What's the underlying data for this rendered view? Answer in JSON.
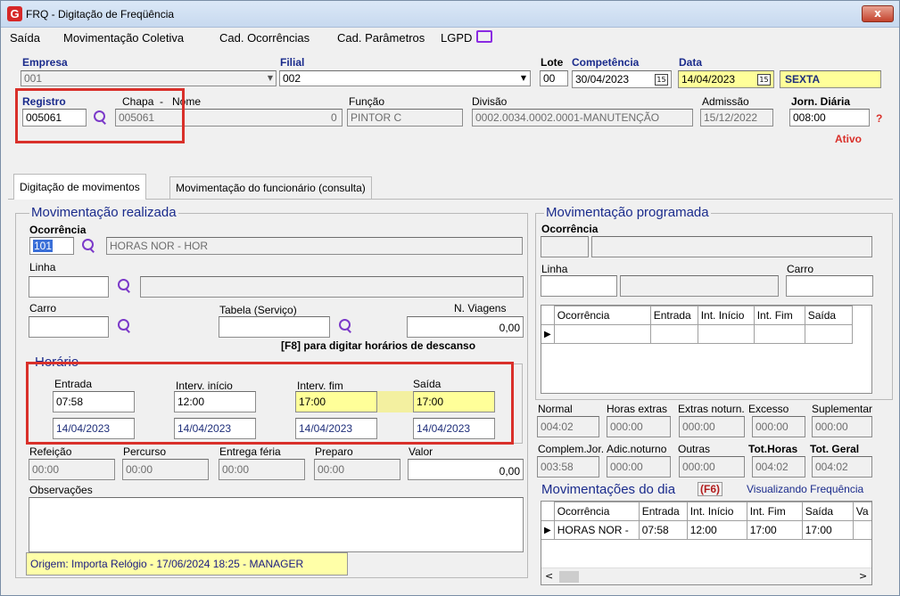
{
  "window": {
    "title": "FRQ - Digitação de Freqüência",
    "close_label": "x",
    "logo": "G"
  },
  "menu": [
    "Saída",
    "Movimentação Coletiva",
    "Cad. Ocorrências",
    "Cad. Parâmetros",
    "LGPD"
  ],
  "header": {
    "empresa_label": "Empresa",
    "empresa_value": "001",
    "filial_label": "Filial",
    "filial_value": "002",
    "lote_label": "Lote",
    "lote_value": "00",
    "competencia_label": "Competência",
    "competencia_value": "30/04/2023",
    "data_label": "Data",
    "data_value": "14/04/2023",
    "dia_semana": "SEXTA",
    "registro_label": "Registro",
    "registro_value": "005061",
    "chapa_label": "Chapa",
    "nome_label": "Nome",
    "chapa_value": "005061",
    "nome_value": "0",
    "funcao_label": "Função",
    "funcao_value": "PINTOR C",
    "divisao_label": "Divisão",
    "divisao_value": "0002.0034.0002.0001-MANUTENÇÃO",
    "admissao_label": "Admissão",
    "admissao_value": "15/12/2022",
    "jornada_label": "Jorn. Diária",
    "jornada_value": "008:00",
    "help": "?",
    "status": "Ativo"
  },
  "tabs": [
    "Digitação de movimentos",
    "Movimentação do funcionário (consulta)"
  ],
  "realizada": {
    "title": "Movimentação realizada",
    "ocorrencia_label": "Ocorrência",
    "ocorrencia_code": "101",
    "ocorrencia_desc": "HORAS NOR - HOR",
    "linha_label": "Linha",
    "carro_label": "Carro",
    "tabela_label": "Tabela (Serviço)",
    "viagens_label": "N. Viagens",
    "viagens_value": "0,00",
    "f8_hint": "[F8] para digitar horários de descanso"
  },
  "horario": {
    "title": "Horário",
    "cols": [
      {
        "label": "Entrada",
        "time": "07:58",
        "date": "14/04/2023"
      },
      {
        "label": "Interv. início",
        "time": "12:00",
        "date": "14/04/2023"
      },
      {
        "label": "Interv. fim",
        "time": "17:00",
        "date": "14/04/2023"
      },
      {
        "label": "Saída",
        "time": "17:00",
        "date": "14/04/2023"
      }
    ]
  },
  "extras": [
    {
      "label": "Refeição",
      "value": "00:00"
    },
    {
      "label": "Percurso",
      "value": "00:00"
    },
    {
      "label": "Entrega féria",
      "value": "00:00"
    },
    {
      "label": "Preparo",
      "value": "00:00"
    },
    {
      "label": "Valor",
      "value": "0,00"
    }
  ],
  "obs_label": "Observações",
  "origem": "Origem: Importa Relógio - 17/06/2024 18:25 - MANAGER",
  "programada": {
    "title": "Movimentação programada",
    "ocorrencia_label": "Ocorrência",
    "linha_label": "Linha",
    "carro_label": "Carro",
    "grid_headers": [
      "Ocorrência",
      "Entrada",
      "Int. Início",
      "Int. Fim",
      "Saída"
    ]
  },
  "totais": [
    {
      "label": "Normal",
      "value": "004:02"
    },
    {
      "label": "Horas extras",
      "value": "000:00"
    },
    {
      "label": "Extras noturn.",
      "value": "000:00"
    },
    {
      "label": "Excesso",
      "value": "000:00"
    },
    {
      "label": "Suplementar",
      "value": "000:00"
    },
    {
      "label": "Complem.Jor.",
      "value": "003:58"
    },
    {
      "label": "Adic.noturno",
      "value": "000:00"
    },
    {
      "label": "Outras",
      "value": "000:00"
    },
    {
      "label": "Tot.Horas",
      "value": "004:02"
    },
    {
      "label": "Tot. Geral",
      "value": "004:02"
    }
  ],
  "dia": {
    "title": "Movimentações do dia",
    "key": "(F6)",
    "link": "Visualizando Frequência",
    "headers": [
      "Ocorrência",
      "Entrada",
      "Int. Início",
      "Int. Fim",
      "Saída",
      "Va"
    ],
    "row": [
      "HORAS NOR -",
      "07:58",
      "12:00",
      "17:00",
      "17:00",
      ""
    ]
  },
  "colors": {
    "accent_red": "#d9302a",
    "highlight_yellow": "#ffff99",
    "label_blue": "#1a2b8c",
    "icon_purple": "#7b39c9"
  }
}
